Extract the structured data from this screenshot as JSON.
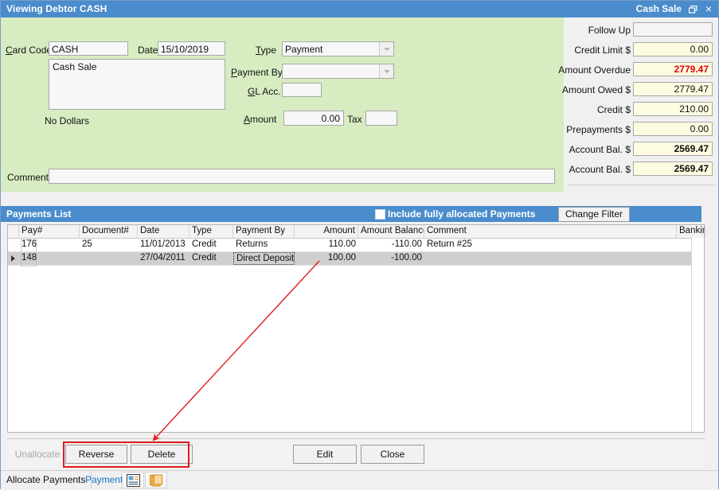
{
  "window": {
    "title_left": "Viewing Debtor CASH",
    "title_right": "Cash Sale",
    "restore_icon": "restore-icon",
    "close_label": "×"
  },
  "form": {
    "card_code_label": "Card Code",
    "card_code_value": "CASH",
    "date_label": "Date",
    "date_value": "15/10/2019",
    "description_value": "Cash Sale",
    "no_dollars_text": "No Dollars",
    "type_label": "Type",
    "type_value": "Payment",
    "payment_by_label": "Payment By",
    "payment_by_value": "",
    "gl_acc_label": "GL Acc.",
    "gl_acc_value": "",
    "amount_label": "Amount",
    "amount_value": "0.00",
    "tax_label": "Tax",
    "tax_value": "",
    "comment_label": "Comment",
    "comment_value": ""
  },
  "summary": {
    "rows": [
      {
        "label": "Follow Up",
        "value": "",
        "style": "plain"
      },
      {
        "label": "Credit Limit $",
        "value": "0.00",
        "style": ""
      },
      {
        "label": "Amount Overdue",
        "value": "2779.47",
        "style": "red"
      },
      {
        "label": "Amount Owed $",
        "value": "2779.47",
        "style": ""
      },
      {
        "label": "Credit $",
        "value": "210.00",
        "style": ""
      },
      {
        "label": "Prepayments $",
        "value": "0.00",
        "style": ""
      },
      {
        "label": "Account Bal. $",
        "value": "2569.47",
        "style": "bold"
      },
      {
        "label": "Account Bal. $",
        "value": "2569.47",
        "style": "bold"
      }
    ]
  },
  "payments_list": {
    "title": "Payments List",
    "include_checkbox_label": "Include fully allocated Payments",
    "include_checkbox_checked": false,
    "change_filter_label": "Change Filter",
    "columns": [
      "Pay#",
      "Document#",
      "Date",
      "Type",
      "Payment By",
      "Amount",
      "Amount Balance",
      "Comment",
      "Banking"
    ],
    "rows": [
      {
        "pay_no": "176",
        "document_no": "25",
        "date": "11/01/2013",
        "type": "Credit",
        "payment_by": "Returns",
        "amount": "110.00",
        "amount_balance": "-110.00",
        "comment": "Return #25",
        "banking": "",
        "selected": false
      },
      {
        "pay_no": "148",
        "document_no": "",
        "date": "27/04/2011",
        "type": "Credit",
        "payment_by": "Direct Deposit",
        "amount": "100.00",
        "amount_balance": "-100.00",
        "comment": "",
        "banking": "",
        "selected": true
      }
    ]
  },
  "buttons": {
    "unallocate": "Unallocate",
    "reverse": "Reverse",
    "delete": "Delete",
    "edit": "Edit",
    "close": "Close"
  },
  "tabs": {
    "allocate_payments": "Allocate Payments",
    "payments": "Payments",
    "icon_report": "report-icon",
    "icon_copy": "copy-documents-icon"
  },
  "annotation": {
    "color": "#e01b1b",
    "arrow_from": "400,327",
    "arrow_to": "188,556"
  }
}
